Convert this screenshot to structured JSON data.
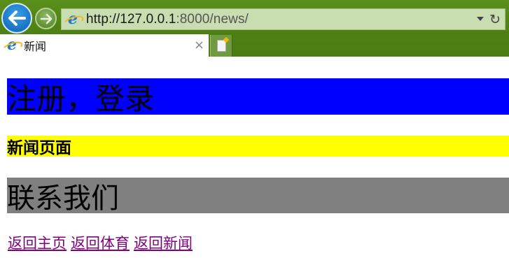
{
  "browser": {
    "url_host": "http://127.0.0.1",
    "url_rest": ":8000/news/",
    "tab_title": "新闻",
    "tab_close": "×",
    "refresh_glyph": "↻"
  },
  "page": {
    "register_login": "注册，登录",
    "news_page": "新闻页面",
    "contact_us": "联系我们",
    "links": [
      "返回主页",
      "返回体育",
      "返回新闻"
    ]
  },
  "colors": {
    "register_bg": "#0000ff",
    "news_bg": "#ffff00",
    "contact_bg": "#808080",
    "visited_link": "#800080"
  }
}
